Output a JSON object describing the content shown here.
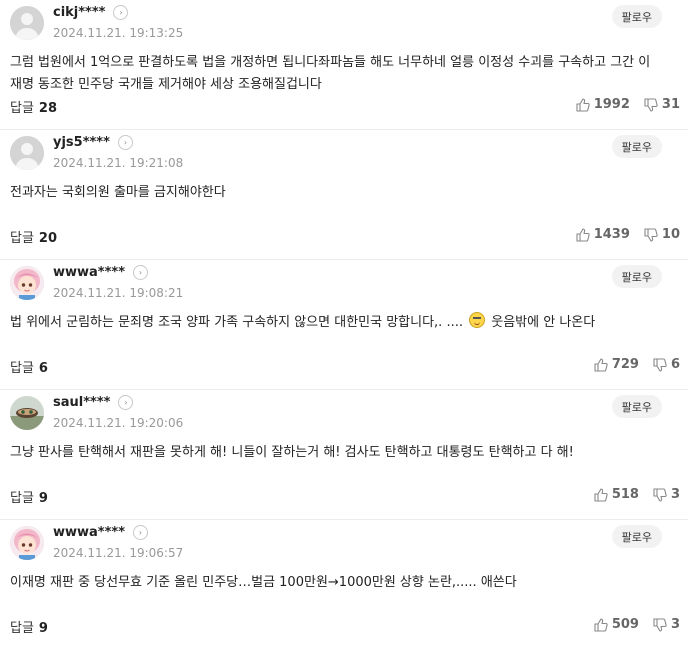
{
  "follow_label": "팔로우",
  "reply_label": "답글",
  "comments": [
    {
      "username": "cikj****",
      "date": "2024.11.21. 19:13:25",
      "avatar": "default-avatar",
      "text": "그럼 법원에서 1억으로 판결하도록 법을 개정하면 됩니다좌파놈들 해도 너무하네 얼릉 이정성 수괴를 구속하고 그간 이재명 동조한 민주당 국개들 제거해야 세상 조용해질겁니다",
      "text_before_emoji": "",
      "text_after_emoji": "",
      "replies": "28",
      "likes": "1992",
      "dislikes": "31"
    },
    {
      "username": "yjs5****",
      "date": "2024.11.21. 19:21:08",
      "avatar": "default-avatar",
      "text": "전과자는 국회의원 출마를 금지해야한다",
      "replies": "20",
      "likes": "1439",
      "dislikes": "10"
    },
    {
      "username": "wwwa****",
      "date": "2024.11.21. 19:08:21",
      "avatar": "cartoon-girl-avatar",
      "text_before_emoji": "법 위에서 군림하는 문죄명 조국 양파 가족 구속하지 않으면 대한민국 망합니다,. ....",
      "text_after_emoji": "웃음밖에 안 나온다",
      "emoji": "grimace-emoji",
      "replies": "6",
      "likes": "729",
      "dislikes": "6"
    },
    {
      "username": "saul****",
      "date": "2024.11.21. 19:20:06",
      "avatar": "photo-avatar",
      "text": "그냥 판사를 탄핵해서 재판을 못하게 해! 니들이 잘하는거 해! 검사도 탄핵하고 대통령도 탄핵하고 다 해!",
      "replies": "9",
      "likes": "518",
      "dislikes": "3"
    },
    {
      "username": "wwwa****",
      "date": "2024.11.21. 19:06:57",
      "avatar": "cartoon-girl-avatar",
      "text": "이재명 재판 중 당선무효 기준 올린 민주당…벌금 100만원→1000만원 상향 논란,..... 애쓴다",
      "replies": "9",
      "likes": "509",
      "dislikes": "3"
    }
  ]
}
